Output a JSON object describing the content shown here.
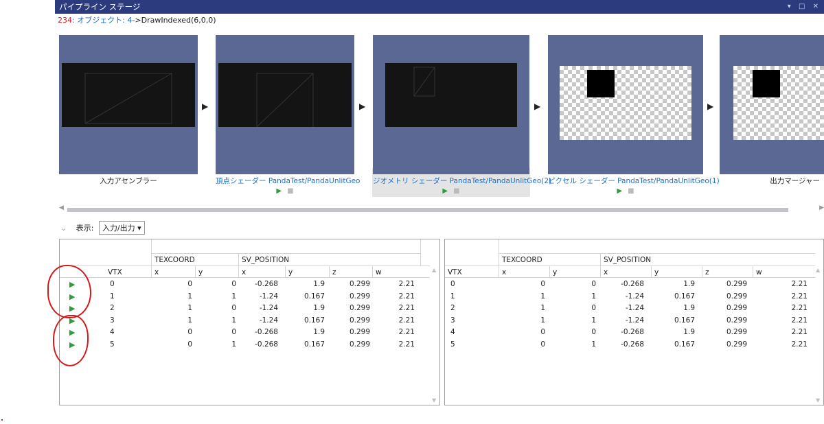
{
  "window": {
    "title": "パイプライン ステージ",
    "controls": "▾ □ ✕"
  },
  "breadcrumb": {
    "event_number": "234",
    "object_link": ": オブジェクト: 4",
    "call": "->DrawIndexed(6,0,0)"
  },
  "stages": [
    {
      "label": "入力アセンブラー"
    },
    {
      "label": "頂点シェーダー PandaTest/PandaUnlitGeo"
    },
    {
      "label": "ジオメトリ シェーダー PandaTest/PandaUnlitGeo(2)"
    },
    {
      "label": "ピクセル シェーダー PandaTest/PandaUnlitGeo(1)"
    },
    {
      "label": "出力マージャー"
    }
  ],
  "view": {
    "label": "表示:",
    "selected": "入力/出力"
  },
  "table": {
    "group_texcoord": "TEXCOORD",
    "group_svposition": "SV_POSITION",
    "col_vtx": "VTX",
    "col_x": "x",
    "col_y": "y",
    "col_z": "z",
    "col_w": "w"
  },
  "left_rows": [
    {
      "vtx": "0",
      "tx": "0",
      "ty": "0",
      "px": "-0.268",
      "py": "1.9",
      "pz": "0.299",
      "pw": "2.21"
    },
    {
      "vtx": "1",
      "tx": "1",
      "ty": "1",
      "px": "-1.24",
      "py": "0.167",
      "pz": "0.299",
      "pw": "2.21"
    },
    {
      "vtx": "2",
      "tx": "1",
      "ty": "0",
      "px": "-1.24",
      "py": "1.9",
      "pz": "0.299",
      "pw": "2.21"
    },
    {
      "vtx": "3",
      "tx": "1",
      "ty": "1",
      "px": "-1.24",
      "py": "0.167",
      "pz": "0.299",
      "pw": "2.21"
    },
    {
      "vtx": "4",
      "tx": "0",
      "ty": "0",
      "px": "-0.268",
      "py": "1.9",
      "pz": "0.299",
      "pw": "2.21"
    },
    {
      "vtx": "5",
      "tx": "0",
      "ty": "1",
      "px": "-0.268",
      "py": "0.167",
      "pz": "0.299",
      "pw": "2.21"
    }
  ],
  "right_rows": [
    {
      "vtx": "0",
      "tx": "0",
      "ty": "0",
      "px": "-0.268",
      "py": "1.9",
      "pz": "0.299",
      "pw": "2.21"
    },
    {
      "vtx": "1",
      "tx": "1",
      "ty": "1",
      "px": "-1.24",
      "py": "0.167",
      "pz": "0.299",
      "pw": "2.21"
    },
    {
      "vtx": "2",
      "tx": "1",
      "ty": "0",
      "px": "-1.24",
      "py": "1.9",
      "pz": "0.299",
      "pw": "2.21"
    },
    {
      "vtx": "3",
      "tx": "1",
      "ty": "1",
      "px": "-1.24",
      "py": "0.167",
      "pz": "0.299",
      "pw": "2.21"
    },
    {
      "vtx": "4",
      "tx": "0",
      "ty": "0",
      "px": "-0.268",
      "py": "1.9",
      "pz": "0.299",
      "pw": "2.21"
    },
    {
      "vtx": "5",
      "tx": "0",
      "ty": "1",
      "px": "-0.268",
      "py": "0.167",
      "pz": "0.299",
      "pw": "2.21"
    }
  ],
  "icons": {
    "play": "play-icon",
    "stop": "stop-icon",
    "arrow": "arrow-right-icon"
  },
  "colors": {
    "titlebar": "#2b3b7e",
    "thumb_bg": "#5b6893",
    "link": "#1f6fc5",
    "play": "#2e9b3e",
    "annotation": "#d11a1a"
  }
}
